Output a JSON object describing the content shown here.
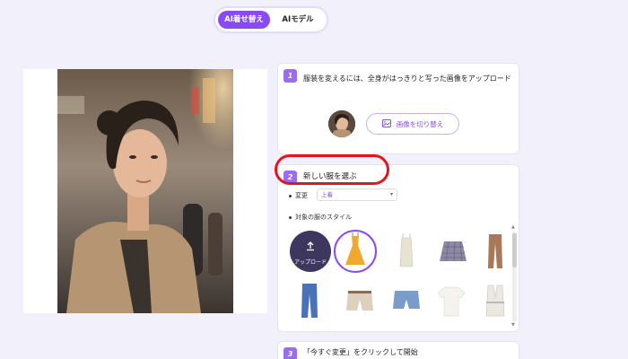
{
  "tabs": [
    {
      "label": "AI着せ替え",
      "active": true
    },
    {
      "label": "AIモデル",
      "active": false
    }
  ],
  "step1": {
    "number": "1",
    "instruction": "服装を変えるには、全身がはっきりと写った画像をアップロード",
    "change_image_label": "画像を切り替え"
  },
  "step2": {
    "number": "2",
    "title": "新しい服を選ぶ",
    "change_label": "変更",
    "change_value": "上着",
    "style_label": "対象の服のスタイル",
    "upload_label": "アップロード",
    "items": [
      {
        "name": "yellow-dress",
        "selected": true
      },
      {
        "name": "white-slip-dress",
        "selected": false
      },
      {
        "name": "plaid-skirt",
        "selected": false
      },
      {
        "name": "brown-trousers",
        "selected": false
      },
      {
        "name": "denim-jeans",
        "selected": false
      },
      {
        "name": "beige-shorts",
        "selected": false
      },
      {
        "name": "denim-shorts",
        "selected": false
      },
      {
        "name": "white-tshirt",
        "selected": false
      },
      {
        "name": "white-vest",
        "selected": false
      }
    ]
  },
  "step3": {
    "number": "3",
    "title": "「今すぐ変更」をクリックして開始"
  },
  "colors": {
    "accent": "#8a4af3",
    "highlight": "#e8141c",
    "background": "#f1f0fb"
  }
}
